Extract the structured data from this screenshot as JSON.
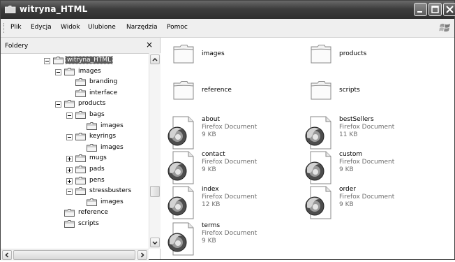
{
  "window": {
    "title": "witryna_HTML"
  },
  "menu": {
    "items": [
      {
        "label": "Plik"
      },
      {
        "label": "Edycja"
      },
      {
        "label": "Widok"
      },
      {
        "label": "Ulubione"
      },
      {
        "label": "Narzędzia"
      },
      {
        "label": "Pomoc"
      }
    ]
  },
  "folders_panel": {
    "title": "Foldery",
    "close_glyph": "×",
    "tree": [
      {
        "label": "witryna_HTML",
        "depth": 0,
        "expander": "minus",
        "selected": true
      },
      {
        "label": "images",
        "depth": 1,
        "expander": "minus"
      },
      {
        "label": "branding",
        "depth": 2,
        "expander": "none"
      },
      {
        "label": "interface",
        "depth": 2,
        "expander": "none"
      },
      {
        "label": "products",
        "depth": 1,
        "expander": "minus"
      },
      {
        "label": "bags",
        "depth": 2,
        "expander": "minus"
      },
      {
        "label": "images",
        "depth": 3,
        "expander": "none"
      },
      {
        "label": "keyrings",
        "depth": 2,
        "expander": "minus"
      },
      {
        "label": "images",
        "depth": 3,
        "expander": "none"
      },
      {
        "label": "mugs",
        "depth": 2,
        "expander": "plus"
      },
      {
        "label": "pads",
        "depth": 2,
        "expander": "plus"
      },
      {
        "label": "pens",
        "depth": 2,
        "expander": "plus"
      },
      {
        "label": "stressbusters",
        "depth": 2,
        "expander": "minus"
      },
      {
        "label": "images",
        "depth": 3,
        "expander": "none"
      },
      {
        "label": "reference",
        "depth": 1,
        "expander": "none"
      },
      {
        "label": "scripts",
        "depth": 1,
        "expander": "none"
      }
    ]
  },
  "content": {
    "folders": [
      {
        "name": "images"
      },
      {
        "name": "products"
      },
      {
        "name": "reference"
      },
      {
        "name": "scripts"
      }
    ],
    "files": [
      {
        "name": "about",
        "type": "Firefox Document",
        "size": "9 KB"
      },
      {
        "name": "bestSellers",
        "type": "Firefox Document",
        "size": "11 KB"
      },
      {
        "name": "contact",
        "type": "Firefox Document",
        "size": "9 KB"
      },
      {
        "name": "custom",
        "type": "Firefox Document",
        "size": "9 KB"
      },
      {
        "name": "index",
        "type": "Firefox Document",
        "size": "12 KB"
      },
      {
        "name": "order",
        "type": "Firefox Document",
        "size": "9 KB"
      },
      {
        "name": "terms",
        "type": "Firefox Document",
        "size": "9 KB"
      }
    ]
  }
}
